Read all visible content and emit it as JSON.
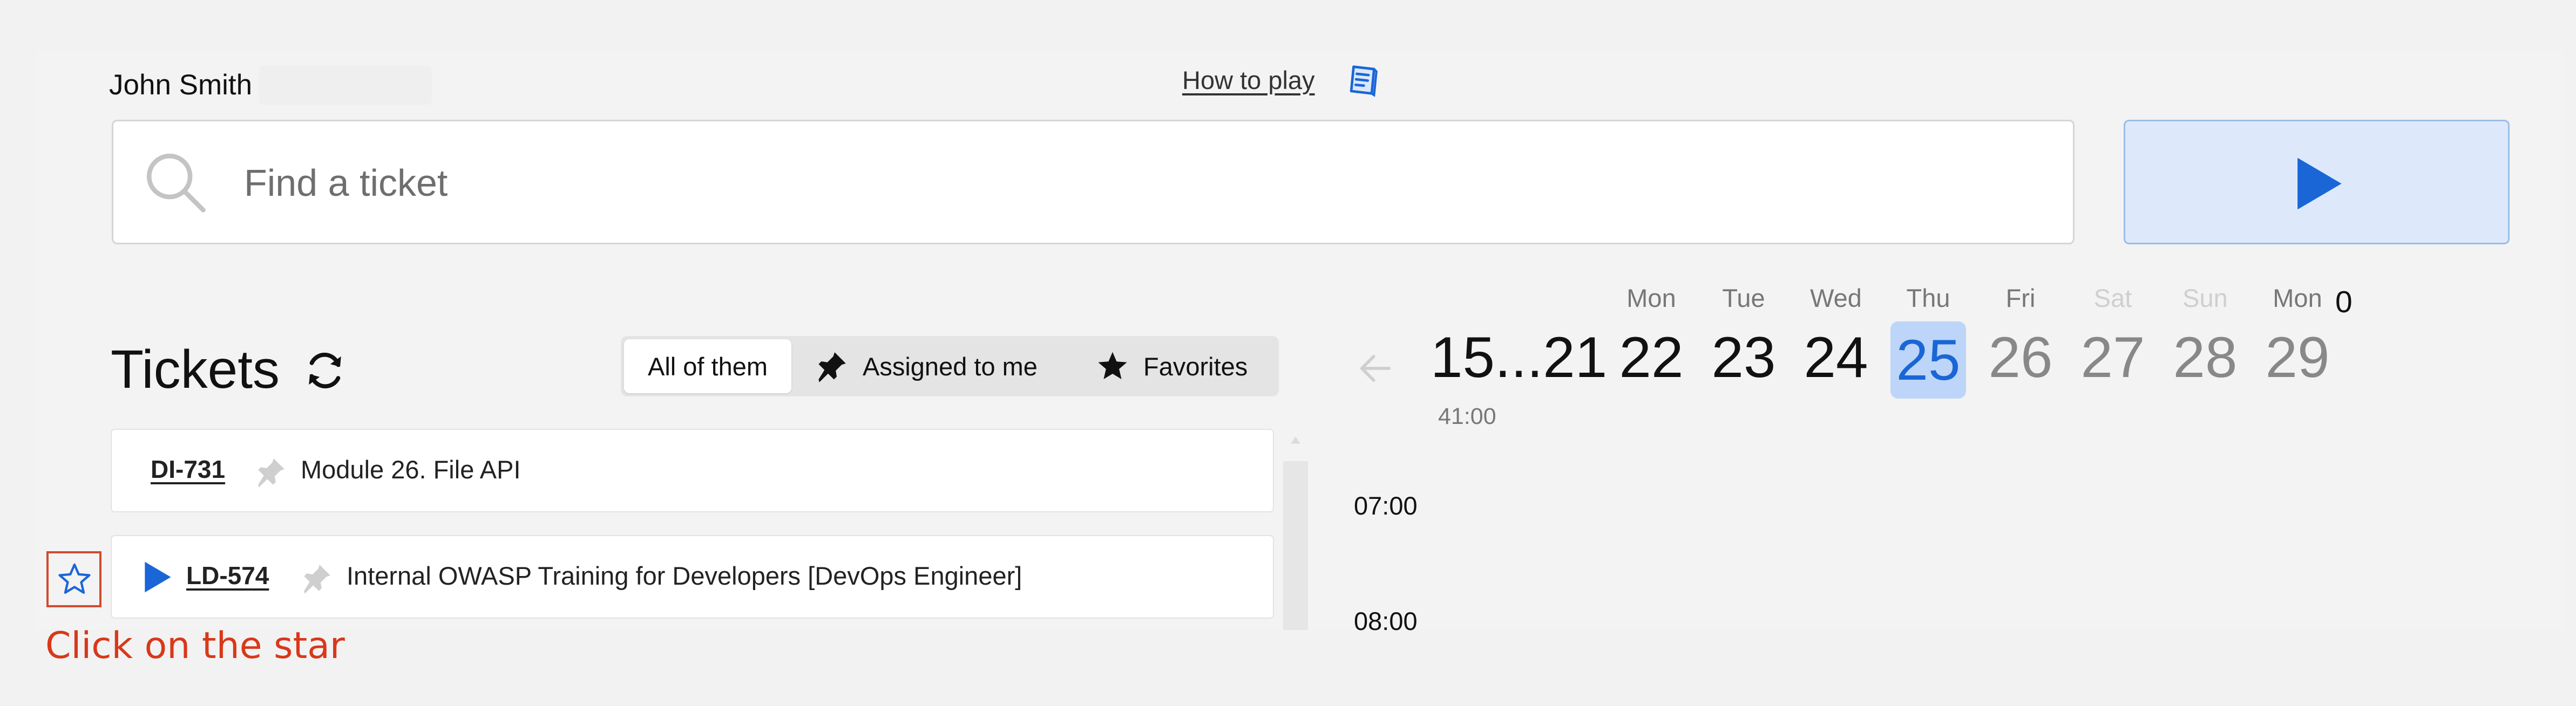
{
  "user": {
    "name": "John Smith"
  },
  "help": {
    "how_to_play": "How to play",
    "icon": "book-icon"
  },
  "search": {
    "placeholder": "Find a ticket",
    "value": ""
  },
  "play_button": {
    "icon": "play-icon"
  },
  "tickets": {
    "title": "Tickets",
    "filters": [
      "All of them",
      "Assigned to me",
      "Favorites"
    ],
    "active_filter": "All of them",
    "rows": [
      {
        "code": "DI-731",
        "title": "Module 26. File API",
        "has_play": false
      },
      {
        "code": "LD-574",
        "title": "Internal OWASP Training for Developers [DevOps Engineer]",
        "has_play": true
      }
    ]
  },
  "calendar": {
    "week_range": "15...21",
    "week_hours": "41:00",
    "days": [
      {
        "name": "Mon",
        "num": "22",
        "state": "normal"
      },
      {
        "name": "Tue",
        "num": "23",
        "state": "normal"
      },
      {
        "name": "Wed",
        "num": "24",
        "state": "normal"
      },
      {
        "name": "Thu",
        "num": "25",
        "state": "today"
      },
      {
        "name": "Fri",
        "num": "26",
        "state": "future"
      },
      {
        "name": "Sat",
        "num": "27",
        "state": "weekend"
      },
      {
        "name": "Sun",
        "num": "28",
        "state": "weekend"
      },
      {
        "name": "Mon",
        "num": "29",
        "state": "future"
      }
    ],
    "week_count": "0",
    "times": [
      "07:00",
      "08:00"
    ]
  },
  "annotation": {
    "text": "Click on the star"
  },
  "colors": {
    "accent": "#1a66d6",
    "today_bg": "#bcd5f8",
    "annotation": "#d8381a"
  }
}
